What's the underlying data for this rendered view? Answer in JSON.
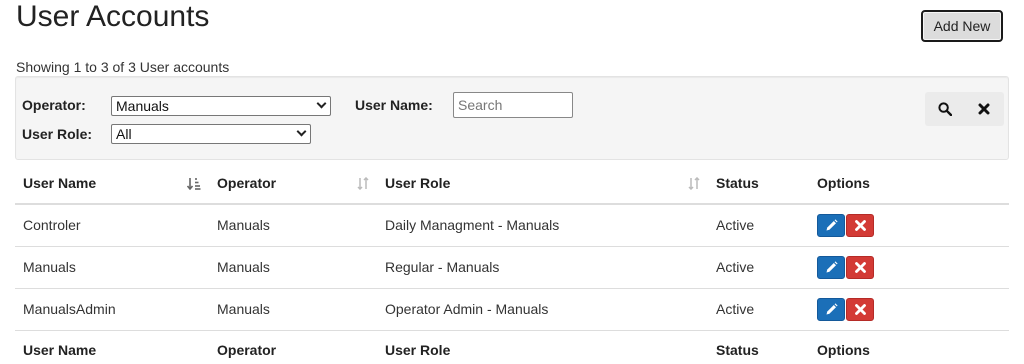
{
  "header": {
    "title": "User Accounts",
    "add_new_label": "Add New",
    "showing_text": "Showing 1 to 3 of 3 User accounts"
  },
  "filters": {
    "operator_label": "Operator:",
    "operator_value": "Manuals",
    "user_name_label": "User Name:",
    "user_name_placeholder": "Search",
    "user_role_label": "User Role:",
    "user_role_value": "All",
    "icons": [
      "search-icon",
      "clear-icon"
    ]
  },
  "table": {
    "columns": [
      "User Name",
      "Operator",
      "User Role",
      "Status",
      "Options"
    ],
    "rows": [
      {
        "user_name": "Controler",
        "operator": "Manuals",
        "user_role": "Daily Managment - Manuals",
        "status": "Active"
      },
      {
        "user_name": "Manuals",
        "operator": "Manuals",
        "user_role": "Regular - Manuals",
        "status": "Active"
      },
      {
        "user_name": "ManualsAdmin",
        "operator": "Manuals",
        "user_role": "Operator Admin - Manuals",
        "status": "Active"
      }
    ],
    "row_icons": [
      "edit-icon",
      "delete-icon"
    ]
  },
  "colors": {
    "edit_button": "#1b6fb8",
    "delete_button": "#d33a35",
    "filter_panel": "#f5f5f5"
  }
}
